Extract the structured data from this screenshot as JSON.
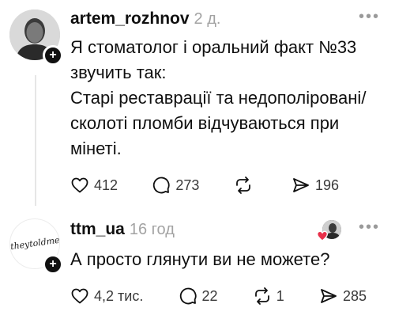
{
  "posts": [
    {
      "username": "artem_rozhnov",
      "time": "2 д.",
      "lines": [
        "Я стоматолог і оральний факт №33",
        "звучить так:",
        "Старі реставрації та недополіровані/",
        "сколоті пломби відчуваються при",
        "мінеті."
      ],
      "actions": {
        "likes": "412",
        "replies": "273",
        "reposts": "",
        "shares": "196"
      }
    },
    {
      "username": "ttm_ua",
      "time": "16 год",
      "avatar_text": "theytoldme",
      "lines": [
        "А просто глянути ви не можете?"
      ],
      "actions": {
        "likes": "4,2 тис.",
        "replies": "22",
        "reposts": "1",
        "shares": "285"
      }
    }
  ],
  "more_icon": "more-dots-icon",
  "colors": {
    "text": "#101010",
    "muted": "#a3a3a3",
    "liked_heart": "#e8304a"
  }
}
